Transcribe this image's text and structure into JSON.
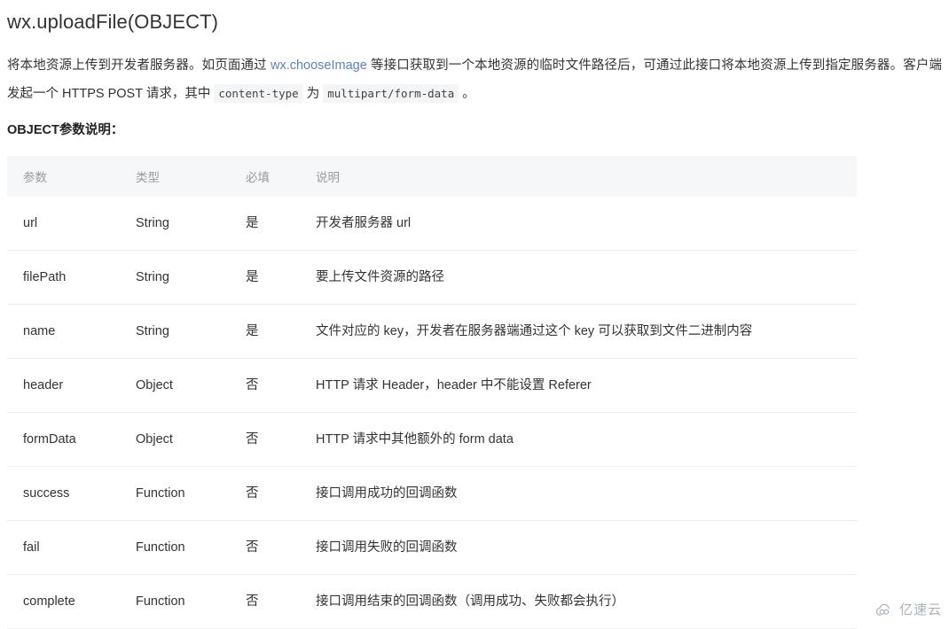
{
  "page": {
    "title": "wx.uploadFile(OBJECT)",
    "subheading": "OBJECT参数说明："
  },
  "intro": {
    "part1": "将本地资源上传到开发者服务器。如页面通过 ",
    "link": "wx.chooseImage",
    "part2": " 等接口获取到一个本地资源的临时文件路径后，可通过此接口将本地资源上传到指定服务器。客户端发起一个 HTTPS POST 请求，其中 ",
    "code1": "content-type",
    "part3": " 为 ",
    "code2": "multipart/form-data",
    "part4": " 。",
    "link_color": "#5b82bd"
  },
  "table": {
    "headers": [
      "参数",
      "类型",
      "必填",
      "说明"
    ],
    "header_bg": "#f6f7f9",
    "border_color": "#eeeeee",
    "rows": [
      {
        "param": "url",
        "type": "String",
        "required": "是",
        "desc": "开发者服务器 url"
      },
      {
        "param": "filePath",
        "type": "String",
        "required": "是",
        "desc": "要上传文件资源的路径"
      },
      {
        "param": "name",
        "type": "String",
        "required": "是",
        "desc": "文件对应的 key，开发者在服务器端通过这个 key 可以获取到文件二进制内容"
      },
      {
        "param": "header",
        "type": "Object",
        "required": "否",
        "desc": "HTTP 请求 Header，header 中不能设置 Referer"
      },
      {
        "param": "formData",
        "type": "Object",
        "required": "否",
        "desc": "HTTP 请求中其他额外的 form data"
      },
      {
        "param": "success",
        "type": "Function",
        "required": "否",
        "desc": "接口调用成功的回调函数"
      },
      {
        "param": "fail",
        "type": "Function",
        "required": "否",
        "desc": "接口调用失败的回调函数"
      },
      {
        "param": "complete",
        "type": "Function",
        "required": "否",
        "desc": "接口调用结束的回调函数（调用成功、失败都会执行）"
      }
    ]
  },
  "watermark": {
    "text": "亿速云",
    "icon": "cloud-infinity-icon",
    "color": "#8a93a3"
  }
}
